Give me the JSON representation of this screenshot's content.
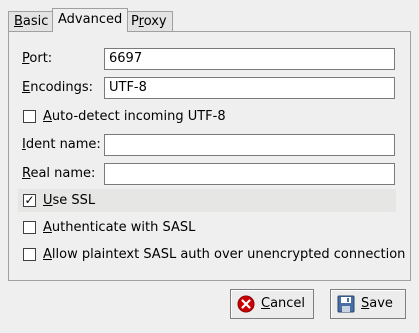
{
  "tabs": [
    {
      "label_mnemonic": "B",
      "label_rest": "asic"
    },
    {
      "label": "Advanced"
    },
    {
      "label_pre": "P",
      "label_mnemonic": "r",
      "label_rest": "oxy"
    }
  ],
  "fields": {
    "port": {
      "label_mnemonic": "P",
      "label_rest": "ort:",
      "value": "6697"
    },
    "encodings": {
      "label_mnemonic": "E",
      "label_rest": "ncodings:",
      "value": "UTF-8"
    },
    "ident": {
      "label_mnemonic": "I",
      "label_rest": "dent name:",
      "value": ""
    },
    "real": {
      "label_mnemonic": "R",
      "label_rest": "eal name:",
      "value": ""
    }
  },
  "checks": {
    "autodetect": {
      "label_mnemonic": "A",
      "label_rest": "uto-detect incoming UTF-8",
      "checked": false
    },
    "ssl": {
      "label_mnemonic": "U",
      "label_rest": "se SSL",
      "checked": true,
      "mark": "✓"
    },
    "sasl": {
      "label_mnemonic": "A",
      "label_rest": "uthenticate with SASL",
      "checked": false
    },
    "plaintext": {
      "label_mnemonic": "A",
      "label_rest": "llow plaintext SASL auth over unencrypted connection",
      "checked": false
    }
  },
  "buttons": {
    "cancel": {
      "label_mnemonic": "C",
      "label_rest": "ancel",
      "icon": "cancel-icon"
    },
    "save": {
      "label_mnemonic": "S",
      "label_rest": "ave",
      "icon": "save-icon"
    }
  },
  "colors": {
    "cancel_icon": "#cc0000",
    "save_icon": "#4a6fa5"
  }
}
